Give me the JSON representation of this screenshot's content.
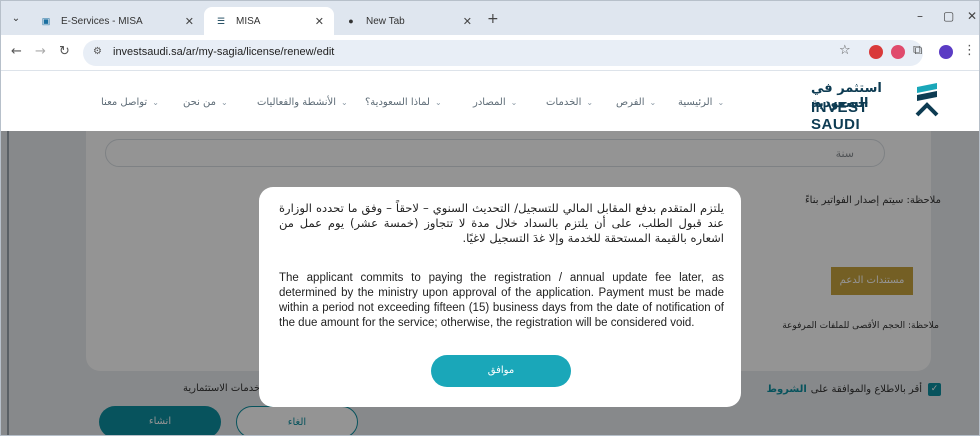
{
  "browser": {
    "tabs": [
      {
        "title": "E-Services - MISA",
        "close": "✕"
      },
      {
        "title": "MISA",
        "close": "✕"
      },
      {
        "title": "New Tab",
        "close": "✕"
      }
    ],
    "new_tab": "+",
    "url": "investsaudi.sa/ar/my-sagia/license/renew/edit"
  },
  "header": {
    "logo_ar": "استثمر في السعودية",
    "logo_en": "INVEST SAUDI",
    "nav": [
      "الرئيسية",
      "الفرص",
      "الخدمات",
      "المصادر",
      "لماذا السعودية؟",
      "الأنشطة والفعاليات",
      "من نحن",
      "تواصل معنا"
    ]
  },
  "page": {
    "field_value": "سنة",
    "note_invoice": "ملاحظة: سيتم إصدار الفواتير بناءً",
    "support_docs": "مستندات الدعم",
    "note_size": "ملاحظة: الحجم الأقصى للملفات المرفوعة",
    "agree_prefix": "أقر بالاطلاع والموافقة على",
    "agree_terms": "الشروط",
    "agree_suffix": "خدمات الاستثمارية.",
    "create_button": "انشاء",
    "cancel_button": "الغاء"
  },
  "modal": {
    "arabic_text": "يلتزم المتقدم بدفع المقابل المالي للتسجيل/ التحديث السنوي – لاحقاً – وفق ما تحدده الوزارة عند قبول الطلب، على أن يلتزم بالسداد خلال مدة لا تتجاوز (خمسة عشر) يوم عمل من اشعاره بالقيمة المستحقة للخدمة وإلا غدَ التسجيل لاغيًا.",
    "english_text": "The applicant commits to paying the registration / annual update fee later, as determined by the ministry upon approval of the application. Payment must be made within a period not exceeding fifteen (15) business days from the date of notification of the due amount for the service; otherwise, the registration will be considered void.",
    "ok_button": "موافق"
  }
}
